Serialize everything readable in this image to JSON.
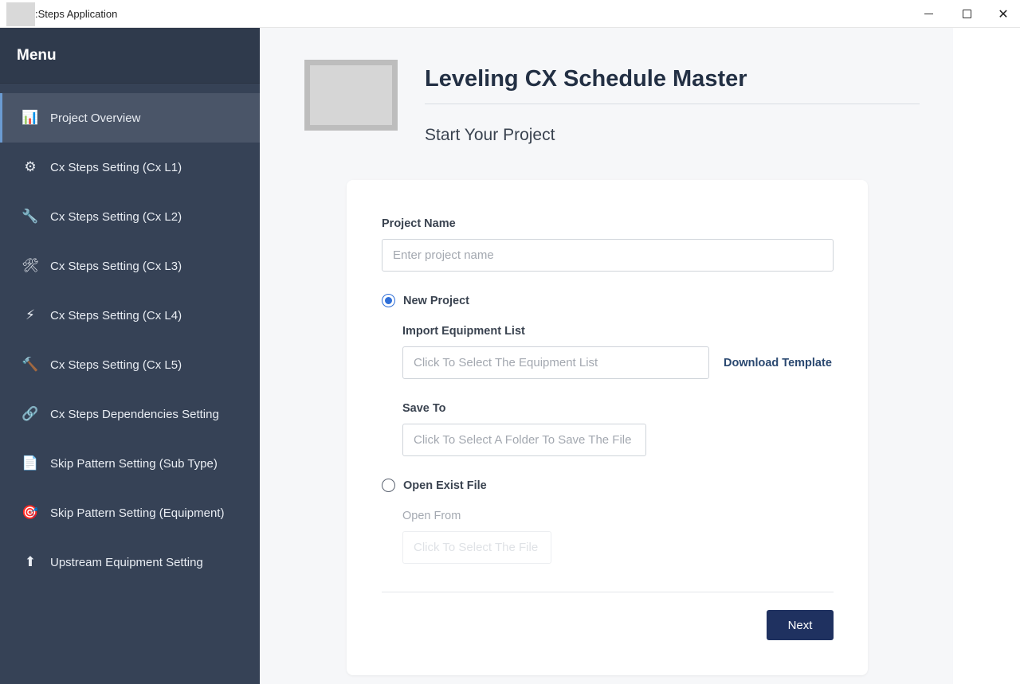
{
  "window": {
    "title": ":Steps Application",
    "minimize_label": "",
    "close_glyph": "✕"
  },
  "sidebar": {
    "header": "Menu",
    "items": [
      {
        "label": "Project Overview",
        "icon": "bar-chart-icon",
        "glyph": "📊",
        "active": true
      },
      {
        "label": "Cx Steps Setting (Cx L1)",
        "icon": "gear-icon",
        "glyph": "⚙",
        "active": false
      },
      {
        "label": "Cx Steps Setting (Cx L2)",
        "icon": "wrench-icon",
        "glyph": "🔧",
        "active": false
      },
      {
        "label": "Cx Steps Setting (Cx L3)",
        "icon": "tools-icon",
        "glyph": "🛠",
        "active": false
      },
      {
        "label": "Cx Steps Setting (Cx L4)",
        "icon": "lightning-icon",
        "glyph": "⚡",
        "active": false
      },
      {
        "label": "Cx Steps Setting (Cx L5)",
        "icon": "hammer-icon",
        "glyph": "🔨",
        "active": false
      },
      {
        "label": "Cx Steps Dependencies Setting",
        "icon": "link-icon",
        "glyph": "🔗",
        "active": false
      },
      {
        "label": "Skip Pattern Setting (Sub Type)",
        "icon": "document-icon",
        "glyph": "📄",
        "active": false
      },
      {
        "label": "Skip Pattern Setting (Equipment)",
        "icon": "target-icon",
        "glyph": "🎯",
        "active": false
      },
      {
        "label": "Upstream Equipment Setting",
        "icon": "up-arrow-icon",
        "glyph": "⬆",
        "active": false
      }
    ]
  },
  "header": {
    "title": "Leveling CX Schedule Master",
    "subtitle": "Start Your Project"
  },
  "form": {
    "project_name_label": "Project Name",
    "project_name_placeholder": "Enter project name",
    "new_project_label": "New Project",
    "new_project_selected": true,
    "import_label": "Import Equipment List",
    "import_placeholder": "Click To Select The Equipment List",
    "download_template": "Download Template",
    "save_to_label": "Save To",
    "save_to_placeholder": "Click To Select A Folder To Save The File",
    "open_exist_label": "Open Exist File",
    "open_exist_selected": false,
    "open_from_label": "Open From",
    "open_from_placeholder": "Click To Select The File",
    "next_label": "Next"
  },
  "colors": {
    "sidebar_bg": "#364256",
    "accent": "#2f6fd8",
    "primary_button": "#1f3160"
  }
}
